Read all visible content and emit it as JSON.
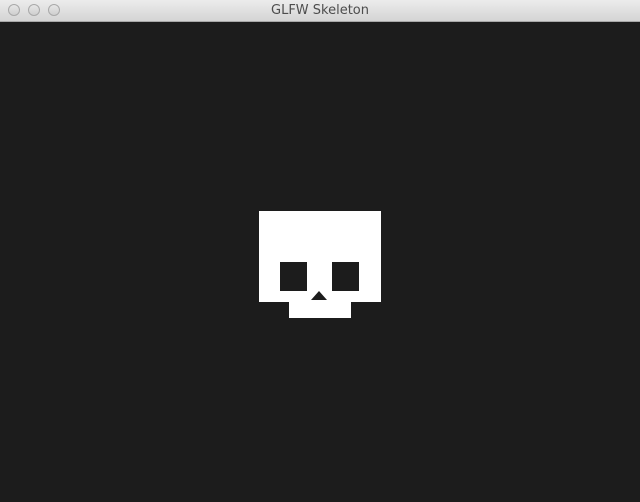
{
  "window": {
    "title": "GLFW Skeleton"
  },
  "titlebar": {
    "buttons": [
      "close",
      "minimize",
      "zoom"
    ]
  },
  "canvas": {
    "background_color": "#1c1c1c",
    "figure": "skull-icon",
    "figure_color": "#ffffff"
  }
}
